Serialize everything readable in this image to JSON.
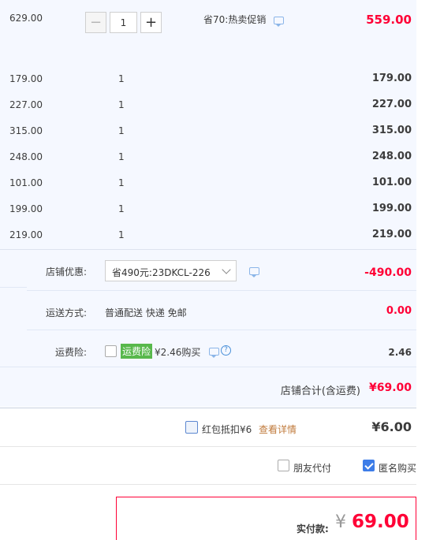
{
  "items": {
    "first": {
      "price": "629.00",
      "quantity": "1",
      "minus": "−",
      "plus": "+",
      "promo": "省70:热卖促销",
      "subtotal": "559.00"
    },
    "rows": [
      {
        "price": "179.00",
        "quantity": "1",
        "subtotal": "179.00"
      },
      {
        "price": "227.00",
        "quantity": "1",
        "subtotal": "227.00"
      },
      {
        "price": "315.00",
        "quantity": "1",
        "subtotal": "315.00"
      },
      {
        "price": "248.00",
        "quantity": "1",
        "subtotal": "248.00"
      },
      {
        "price": "101.00",
        "quantity": "1",
        "subtotal": "101.00"
      },
      {
        "price": "199.00",
        "quantity": "1",
        "subtotal": "199.00"
      },
      {
        "price": "219.00",
        "quantity": "1",
        "subtotal": "219.00"
      }
    ]
  },
  "store": {
    "discount_label": "店铺优惠:",
    "coupon_selected": "省490元:23DKCL-226",
    "discount_value": "-490.00",
    "shipping_label": "运送方式:",
    "shipping_method": "普通配送 快递 免邮",
    "shipping_value": "0.00",
    "insurance_label": "运费险:",
    "insurance_badge": "运费险",
    "insurance_price": "¥2.46购买",
    "insurance_value": "2.46",
    "total_label": "店铺合计(含运费)",
    "total_value": "¥69.00"
  },
  "hongbao": {
    "label": "红包抵扣¥6",
    "link": "查看详情",
    "value": "¥6.00"
  },
  "options": {
    "friend_pay": "朋友代付",
    "anonymous": "匿名购买",
    "friend_pay_checked": false,
    "anonymous_checked": true
  },
  "payment": {
    "label": "实付款:",
    "currency": "¥",
    "value": "69.00"
  },
  "colors": {
    "accent": "#ff0036",
    "insurance_badge": "#58b84b",
    "link": "#c07a3b",
    "panel_bg": "#f5f8ff"
  }
}
